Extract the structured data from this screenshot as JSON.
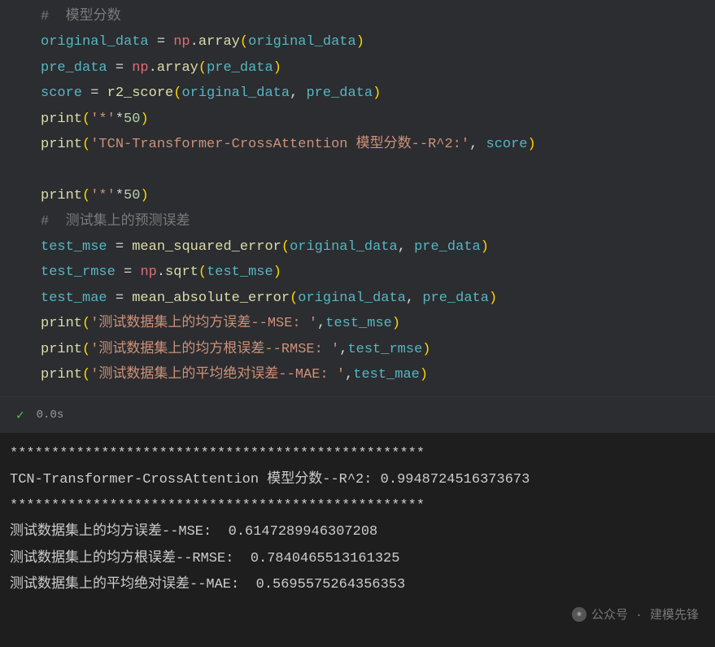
{
  "code": {
    "comment1": "#  模型分数",
    "l2_var": "original_data",
    "l2_np": "np",
    "l2_func": "array",
    "l2_arg": "original_data",
    "l3_var": "pre_data",
    "l3_arg": "pre_data",
    "l4_var": "score",
    "l4_func": "r2_score",
    "l4_arg1": "original_data",
    "l4_arg2": "pre_data",
    "print": "print",
    "star": "'*'",
    "fifty": "50",
    "l6_str": "'TCN-Transformer-CrossAttention 模型分数--R^2:'",
    "l6_arg": "score",
    "comment2": "#  测试集上的预测误差",
    "l9_var": "test_mse",
    "l9_func": "mean_squared_error",
    "l10_var": "test_rmse",
    "l10_func": "sqrt",
    "l10_arg": "test_mse",
    "l11_var": "test_mae",
    "l11_func": "mean_absolute_error",
    "l12_str": "'测试数据集上的均方误差--MSE: '",
    "l12_arg": "test_mse",
    "l13_str": "'测试数据集上的均方根误差--RMSE: '",
    "l13_arg": "test_rmse",
    "l14_str": "'测试数据集上的平均绝对误差--MAE: '",
    "l14_arg": "test_mae"
  },
  "status": {
    "time": "0.0s"
  },
  "output": {
    "l1": "**************************************************",
    "l2": "TCN-Transformer-CrossAttention 模型分数--R^2: 0.9948724516373673",
    "l3": "**************************************************",
    "l4": "测试数据集上的均方误差--MSE:  0.6147289946307208",
    "l5": "测试数据集上的均方根误差--RMSE:  0.7840465513161325",
    "l6": "测试数据集上的平均绝对误差--MAE:  0.5695575264356353"
  },
  "watermark": " 公众号 · 建模先锋"
}
